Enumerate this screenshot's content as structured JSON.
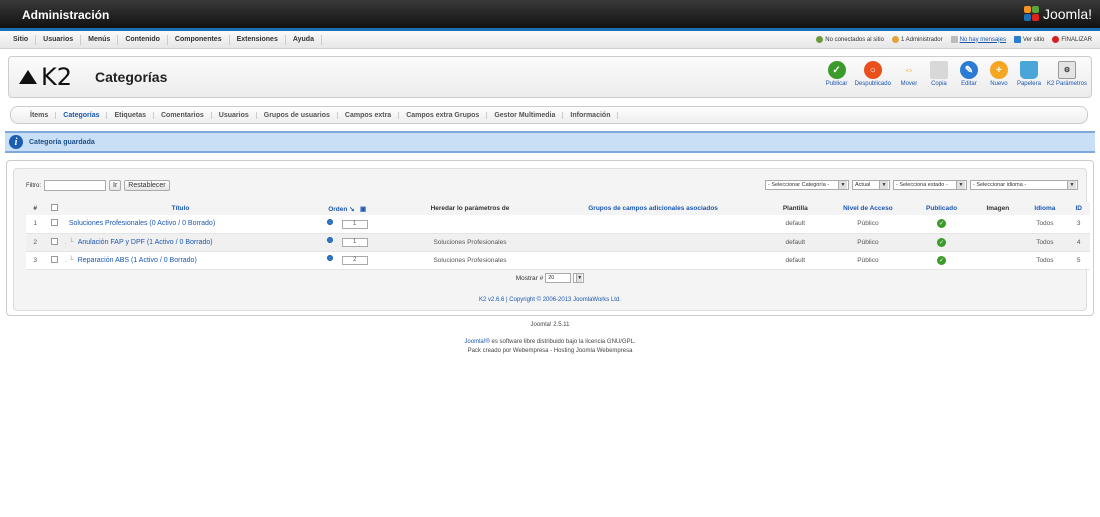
{
  "app": {
    "title": "Administración",
    "brand": "Joomla!"
  },
  "menu": [
    "Sitio",
    "Usuarios",
    "Menús",
    "Contenido",
    "Componentes",
    "Extensiones",
    "Ayuda"
  ],
  "status": {
    "visitors": "No conectados al sitio",
    "admins": "1 Administrador",
    "messages": "No hay mensajes",
    "view_site": "Ver sitio",
    "logout": "FINALIZAR"
  },
  "toolbar": {
    "logo_text": "K2",
    "page_title": "Categorías",
    "buttons": [
      {
        "label": "Publicar",
        "icon": "check-icon",
        "color": "#3a9a2a"
      },
      {
        "label": "Despublicado",
        "icon": "unpublish-icon",
        "color": "#e94e1b"
      },
      {
        "label": "Mover",
        "icon": "move-arrows-icon",
        "color": "#f39c12"
      },
      {
        "label": "Copia",
        "icon": "copy-icon",
        "color": "#bdbdbd"
      },
      {
        "label": "Editar",
        "icon": "edit-pencil-icon",
        "color": "#2a7bd2"
      },
      {
        "label": "Nuevo",
        "icon": "add-icon",
        "color": "#f5a623"
      },
      {
        "label": "Papelera",
        "icon": "trash-icon",
        "color": "#4aa6d8"
      },
      {
        "label": "K2 Parámetros",
        "icon": "parameters-icon",
        "color": "#cfcfcf"
      }
    ]
  },
  "subnav": [
    "Ítems",
    "Categorías",
    "Etiquetas",
    "Comentarios",
    "Usuarios",
    "Grupos de usuarios",
    "Campos extra",
    "Campos extra Grupos",
    "Gestor Multimedia",
    "Información"
  ],
  "message": "Categoría guardada",
  "filter": {
    "label": "Filtro:",
    "value": "",
    "go": "Ir",
    "reset": "Restablecer"
  },
  "selects": [
    "- Seleccionar Categoría -",
    "Actual",
    "- Selecciona estado -",
    "- Seleccionar idioma -"
  ],
  "table": {
    "headers": {
      "num": "#",
      "title": "Título",
      "order": "Orden",
      "inherit": "Heredar lo parámetros de",
      "groups": "Grupos de campos adicionales asociados",
      "template": "Plantilla",
      "access": "Nivel de Acceso",
      "published": "Publicado",
      "image": "Imagen",
      "language": "Idioma",
      "id": "ID"
    },
    "rows": [
      {
        "num": "1",
        "title": "Soluciones Profesionales (0 Activo / 0 Borrado)",
        "indent": "",
        "order": "1",
        "inherit": "",
        "groups": "",
        "template": "default",
        "access": "Público",
        "language": "Todos",
        "id": "3"
      },
      {
        "num": "2",
        "title": "Anulación FAP y DPF (1 Activo / 0 Borrado)",
        "indent": ". └",
        "order": "1",
        "inherit": "Soluciones Profesionales",
        "groups": "",
        "template": "default",
        "access": "Público",
        "language": "Todos",
        "id": "4"
      },
      {
        "num": "3",
        "title": "Reparación ABS (1 Activo / 0 Borrado)",
        "indent": ". └",
        "order": "2",
        "inherit": "Soluciones Profesionales",
        "groups": "",
        "template": "default",
        "access": "Público",
        "language": "Todos",
        "id": "5"
      }
    ]
  },
  "pager": {
    "label": "Mostrar #",
    "value": "20"
  },
  "credit": {
    "prefix": "K2 v2.6.6 | Copyright © 2006-2013 ",
    "link": "JoomlaWorks Ltd."
  },
  "footer": {
    "version": "Joomla! 2.5.11",
    "license_link": "Joomla!®",
    "license_text": " es software libre distribuido bajo la licencia GNU/GPL.",
    "pack": "Pack creado por Webempresa - Hosting Joomla Webempresa"
  }
}
